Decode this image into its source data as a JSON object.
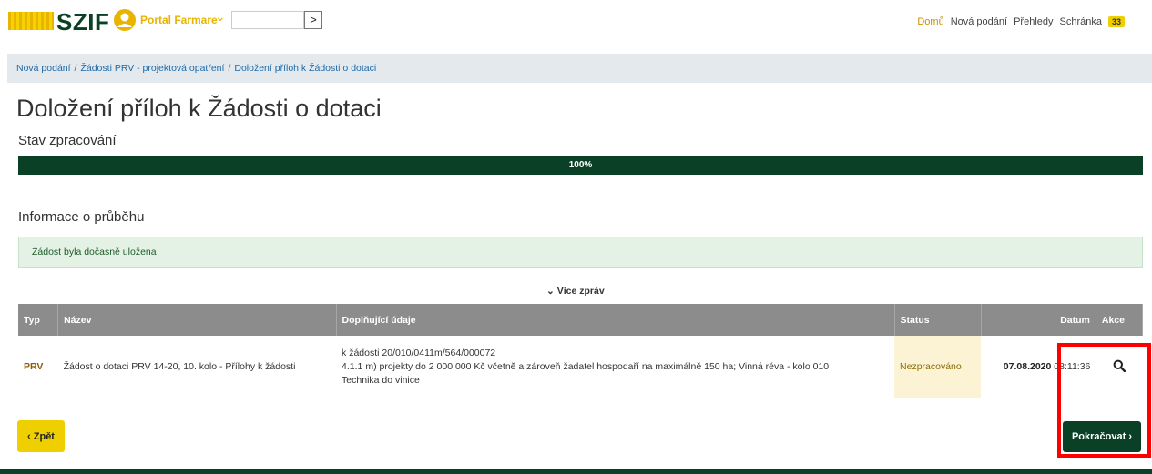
{
  "header": {
    "logo": "SZIF",
    "portal_label": "Portal Farmare",
    "search_button": ">",
    "nav": {
      "home": "Domů",
      "new_submissions": "Nová podání",
      "overviews": "Přehledy",
      "inbox": "Schránka",
      "inbox_count": "33"
    }
  },
  "breadcrumb": [
    "Nová podání",
    "Žádosti PRV - projektová opatření",
    "Doložení příloh k Žádosti o dotaci"
  ],
  "page_title": "Doložení příloh k Žádosti o dotaci",
  "progress": {
    "label": "Stav zpracování",
    "value": 1.0,
    "text": "100%"
  },
  "info": {
    "label": "Informace o průběhu",
    "message": "Žádost byla dočasně uložena",
    "more_messages": "Více zpráv"
  },
  "table": {
    "headers": {
      "typ": "Typ",
      "nazev": "Název",
      "udaje": "Doplňující údaje",
      "status": "Status",
      "datum": "Datum",
      "akce": "Akce"
    },
    "rows": [
      {
        "typ": "PRV",
        "nazev": "Žádost o dotaci PRV 14-20, 10. kolo - Přílohy k žádosti",
        "udaje_1": "k žádosti 20/010/0411m/564/000072",
        "udaje_2": "4.1.1 m) projekty do 2 000 000 Kč včetně a zároveň žadatel hospodaří na maximálně 150 ha; Vinná réva - kolo 010",
        "udaje_3": "Technika do vinice",
        "status": "Nezpracováno",
        "datum_date": "07.08.2020",
        "datum_time": "08:11:36"
      }
    ]
  },
  "buttons": {
    "back": "Zpět",
    "next": "Pokračovat"
  },
  "colors": {
    "brand_green": "#0a4126",
    "brand_yellow": "#f0cf00",
    "highlight_red": "#ff0000"
  }
}
